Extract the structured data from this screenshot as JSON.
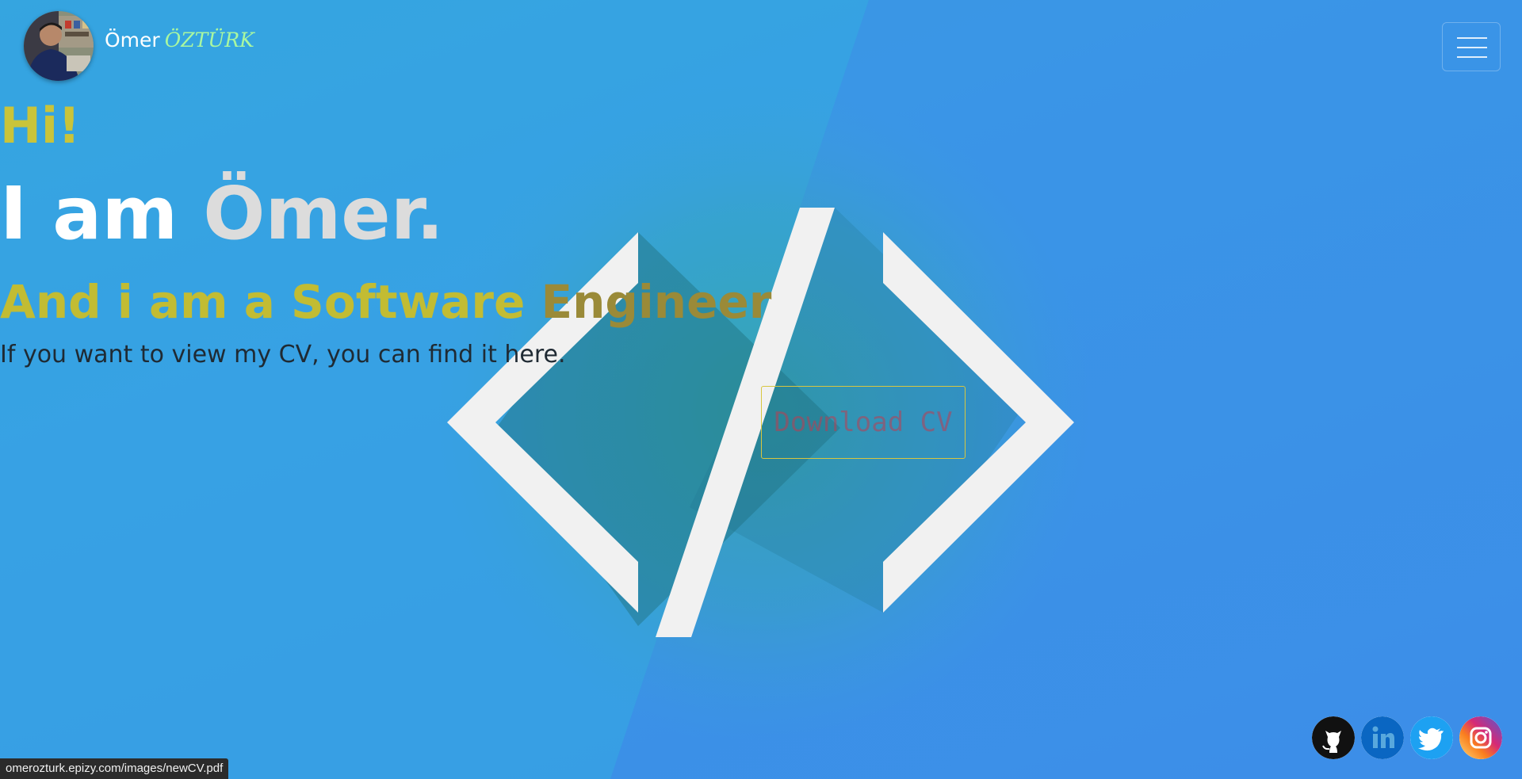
{
  "header": {
    "avatar_alt": "Profile photo",
    "brand_first": "Ömer",
    "brand_last": "ÖZTÜRK",
    "menu_icon": "hamburger-menu-icon"
  },
  "hero": {
    "greeting": "Hi!",
    "intro_prefix": "I am ",
    "intro_name": "Ömer.",
    "role_main": "And i am a Software ",
    "role_tail": "Engineer",
    "cv_prompt": "If you want to view my CV, you can find it here.",
    "download_label": "Download CV",
    "background_icon": "code-brackets-icon"
  },
  "social": [
    {
      "name": "github",
      "icon": "github-icon",
      "color": "#111111"
    },
    {
      "name": "linkedin",
      "icon": "linkedin-icon",
      "color": "#0a66c2"
    },
    {
      "name": "twitter",
      "icon": "twitter-icon",
      "color": "#1da1f2"
    },
    {
      "name": "instagram",
      "icon": "instagram-icon",
      "color": "#e1306c"
    }
  ],
  "status_bar": {
    "url": "omerozturk.epizy.com/images/newCV.pdf"
  },
  "colors": {
    "accent_yellow": "#c9c43a",
    "brand_green": "#a9f7a0",
    "background_blue": "#3a9ae6"
  }
}
